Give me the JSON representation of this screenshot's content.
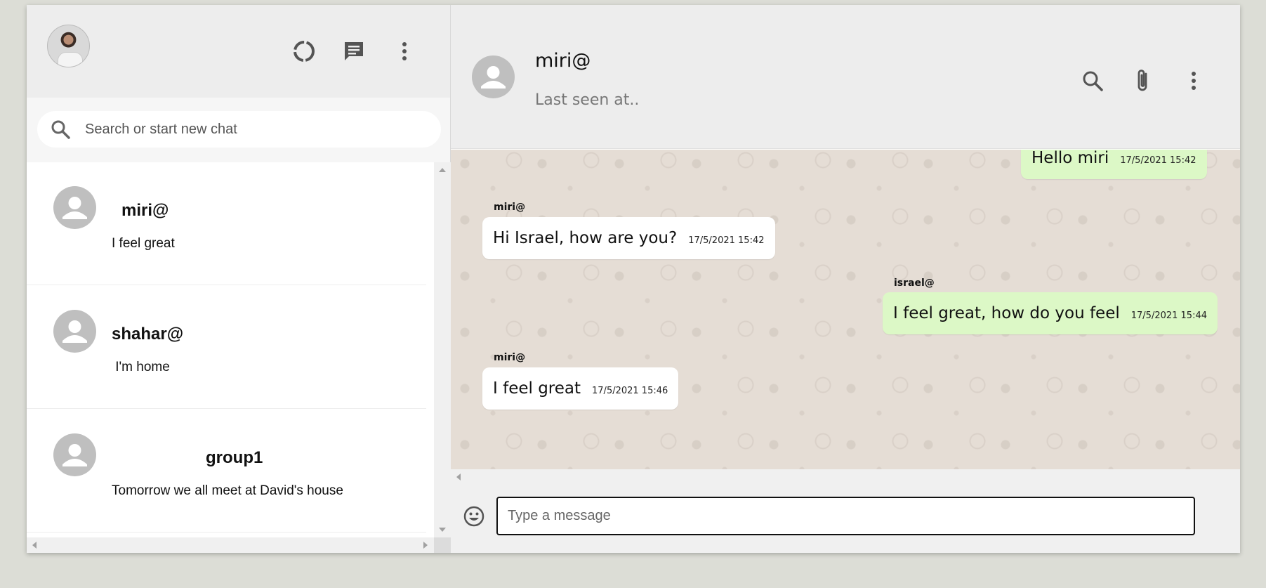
{
  "sidebar": {
    "header": {
      "avatar_label": "my-profile",
      "icons": [
        "status-icon",
        "new-chat-icon",
        "menu-dots-icon"
      ]
    },
    "search": {
      "placeholder": "Search or start new chat"
    },
    "chats": [
      {
        "name": "miri@",
        "last_message": "I feel great"
      },
      {
        "name": "shahar@",
        "last_message": " I'm home"
      },
      {
        "name": "group1",
        "last_message": "Tomorrow we all meet at David's house"
      }
    ]
  },
  "conversation": {
    "contact_name": "miri@",
    "contact_status": "Last seen at..",
    "icons": [
      "search-icon",
      "paperclip-icon",
      "menu-dots-icon"
    ],
    "messages": [
      {
        "sender": "",
        "text": "Hello miri",
        "time": "17/5/2021 15:42",
        "direction": "out"
      },
      {
        "sender": "miri@",
        "text": "Hi Israel, how are you?",
        "time": "17/5/2021 15:42",
        "direction": "in"
      },
      {
        "sender": "israel@",
        "text": "I feel great, how do you feel",
        "time": "17/5/2021 15:44",
        "direction": "out"
      },
      {
        "sender": "miri@",
        "text": "I feel great",
        "time": "17/5/2021 15:46",
        "direction": "in"
      }
    ],
    "composer": {
      "placeholder": "Type a message"
    }
  },
  "colors": {
    "header_bg": "#ededed",
    "chat_bg": "#e5ddd5",
    "outgoing_bubble": "#dcf8c6",
    "incoming_bubble": "#ffffff",
    "icon_gray": "#545454"
  }
}
